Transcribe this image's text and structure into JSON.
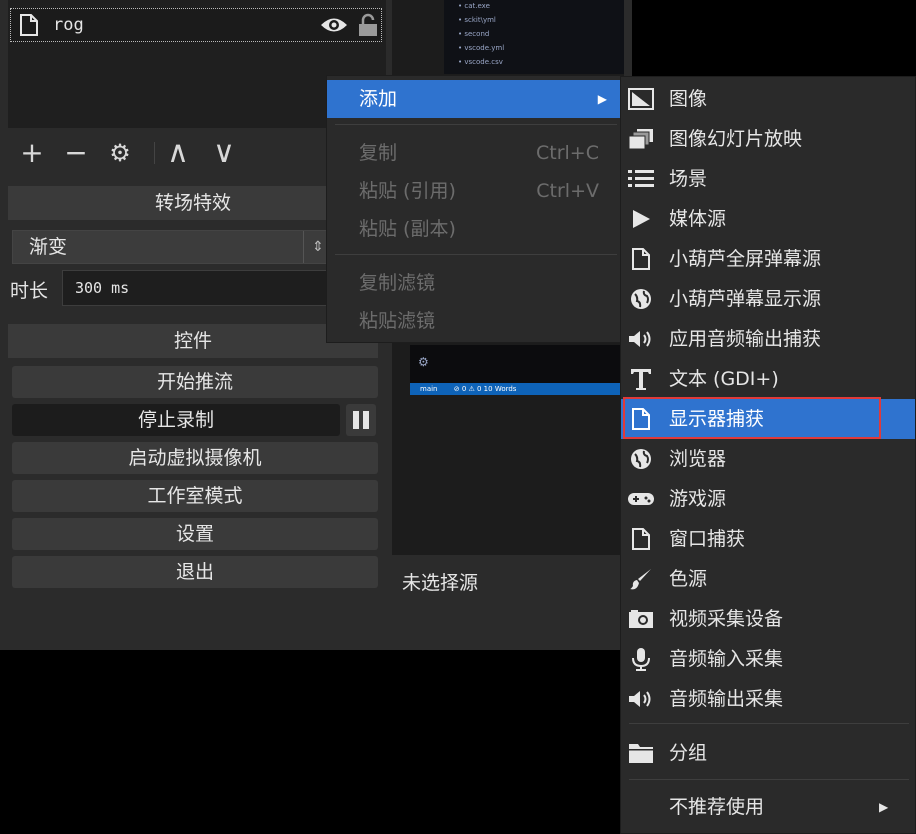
{
  "sources": {
    "item_name": "rog"
  },
  "toolbar": {
    "add": "+",
    "remove": "−",
    "settings": "⚙",
    "up": "∧",
    "down": "∨"
  },
  "transitions": {
    "header": "转场特效",
    "selected": "渐变",
    "duration_label": "时长",
    "duration_value": "300 ms"
  },
  "controls": {
    "header": "控件",
    "start_stream": "开始推流",
    "stop_record": "停止录制",
    "start_virtual_cam": "启动虚拟摄像机",
    "studio_mode": "工作室模式",
    "settings": "设置",
    "exit": "退出"
  },
  "preview": {
    "no_source": "未选择源",
    "status_branch": "main",
    "status_text": "⊘ 0 ⚠ 0   10 Words",
    "code_lines": [
      "• cat.exe",
      "• sckit\\yml",
      "• second",
      "• vscode.yml",
      "• vscode.csv"
    ]
  },
  "context_menu": {
    "add": "添加",
    "copy": "复制",
    "copy_shortcut": "Ctrl+C",
    "paste_ref": "粘贴 (引用)",
    "paste_ref_shortcut": "Ctrl+V",
    "paste_dup": "粘贴 (副本)",
    "copy_filters": "复制滤镜",
    "paste_filters": "粘贴滤镜"
  },
  "submenu": {
    "items": [
      {
        "label": "图像",
        "icon": "image-icon"
      },
      {
        "label": "图像幻灯片放映",
        "icon": "slideshow-icon"
      },
      {
        "label": "场景",
        "icon": "list-icon"
      },
      {
        "label": "媒体源",
        "icon": "play-icon"
      },
      {
        "label": "小葫芦全屏弹幕源",
        "icon": "file-icon"
      },
      {
        "label": "小葫芦弹幕显示源",
        "icon": "globe-icon"
      },
      {
        "label": "应用音频输出捕获",
        "icon": "speaker-icon"
      },
      {
        "label": "文本 (GDI+)",
        "icon": "text-icon"
      },
      {
        "label": "显示器捕获",
        "icon": "file-icon"
      },
      {
        "label": "浏览器",
        "icon": "globe-icon"
      },
      {
        "label": "游戏源",
        "icon": "gamepad-icon"
      },
      {
        "label": "窗口捕获",
        "icon": "file-icon"
      },
      {
        "label": "色源",
        "icon": "brush-icon"
      },
      {
        "label": "视频采集设备",
        "icon": "camera-icon"
      },
      {
        "label": "音频输入采集",
        "icon": "microphone-icon"
      },
      {
        "label": "音频输出采集",
        "icon": "speaker-icon"
      }
    ],
    "group": "分组",
    "deprecated": "不推荐使用"
  },
  "colors": {
    "accent": "#2f73cf",
    "highlight_border": "#e03a3a"
  }
}
